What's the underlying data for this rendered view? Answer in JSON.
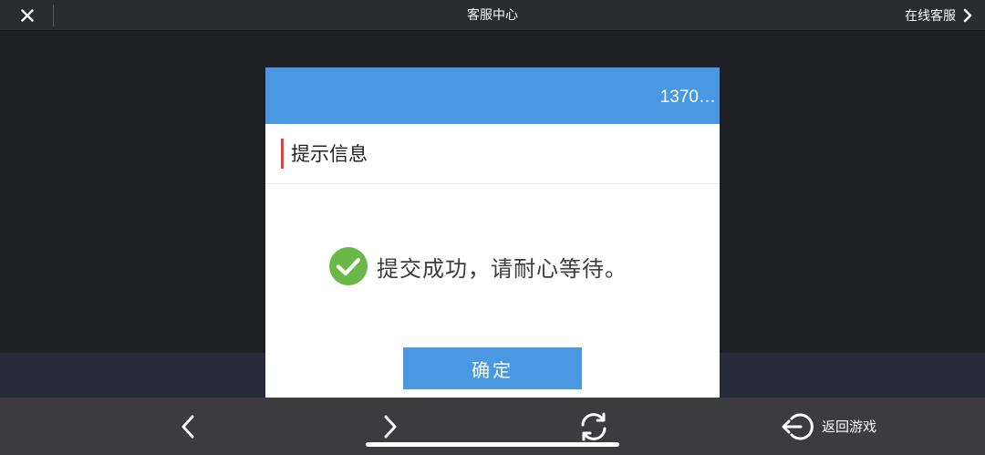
{
  "topbar": {
    "title": "客服中心",
    "online_service_label": "在线客服",
    "close_icon": "close-icon",
    "chevron_icon": "chevron-right-icon"
  },
  "dialog": {
    "account": "1370…",
    "title": "提示信息",
    "message": "提交成功，请耐心等待。",
    "success_icon": "check-circle-icon",
    "confirm_label": "确定"
  },
  "toolbar": {
    "back_icon": "chevron-left-icon",
    "forward_icon": "chevron-right-icon",
    "refresh_icon": "refresh-icon",
    "return_game_icon": "exit-icon",
    "return_game_label": "返回游戏"
  },
  "colors": {
    "header_blue": "#4a98e1",
    "accent_red": "#e0413b",
    "success_green": "#6bb84a",
    "topbar_bg": "#2b2c2f",
    "toolbar_bg": "#3c3c3e"
  }
}
